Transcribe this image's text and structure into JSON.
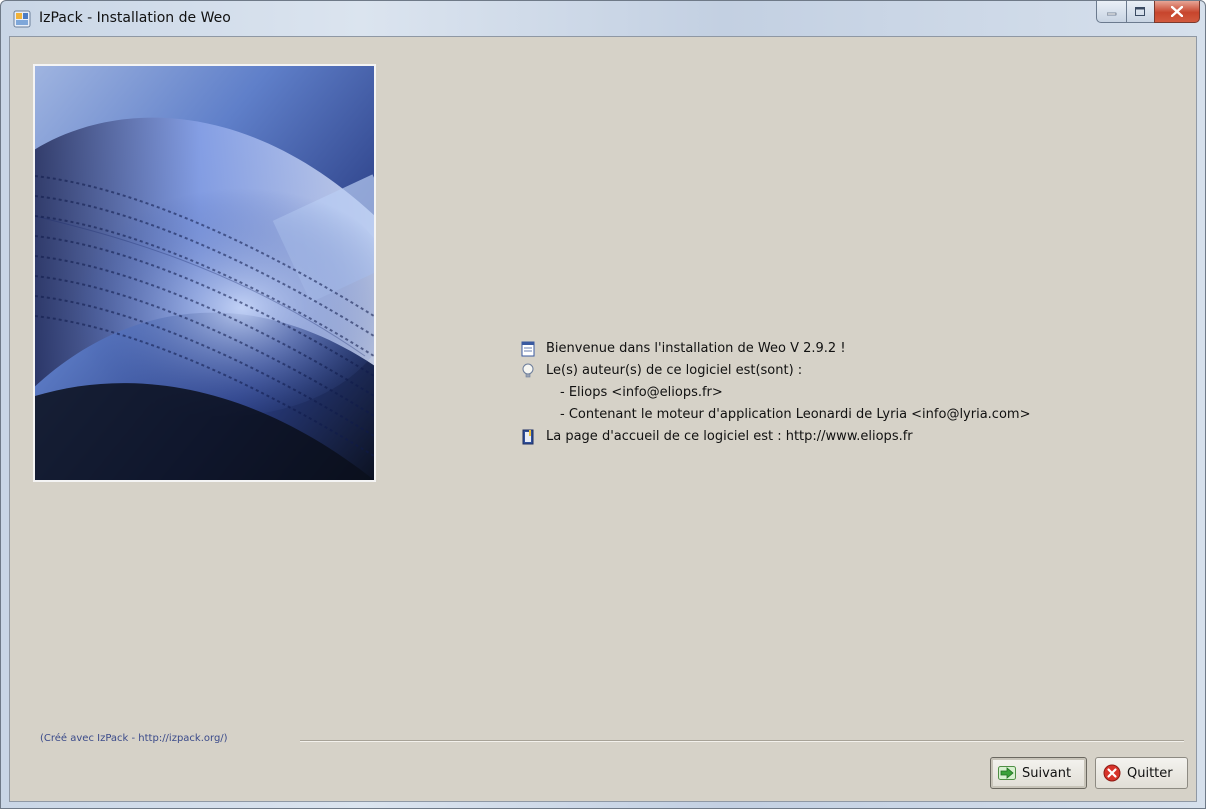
{
  "window": {
    "title": "IzPack - Installation de Weo",
    "app_icon": "izpack-app-icon",
    "controls": [
      "minimize-icon",
      "maximize-icon",
      "close-icon"
    ]
  },
  "info": {
    "welcome": "Bienvenue dans l'installation de Weo V 2.9.2 !",
    "authors_heading": "Le(s) auteur(s) de ce logiciel est(sont) :",
    "authors": [
      "- Eliops <info@eliops.fr>",
      "- Contenant le moteur d'application Leonardi de Lyria <info@lyria.com>"
    ],
    "homepage": "La page d'accueil de ce logiciel est : http://www.eliops.fr",
    "icons": [
      "document-icon",
      "lightbulb-icon",
      "book-icon"
    ]
  },
  "footer": {
    "credit": "(Créé avec IzPack - http://izpack.org/)"
  },
  "buttons": {
    "next_label": "Suivant",
    "quit_label": "Quitter",
    "next_icon": "arrow-right-icon",
    "quit_icon": "cancel-icon"
  },
  "colors": {
    "panel_bg": "#d6d2c8",
    "credit_text": "#3a4a8a",
    "close_button": "#c7452d"
  }
}
